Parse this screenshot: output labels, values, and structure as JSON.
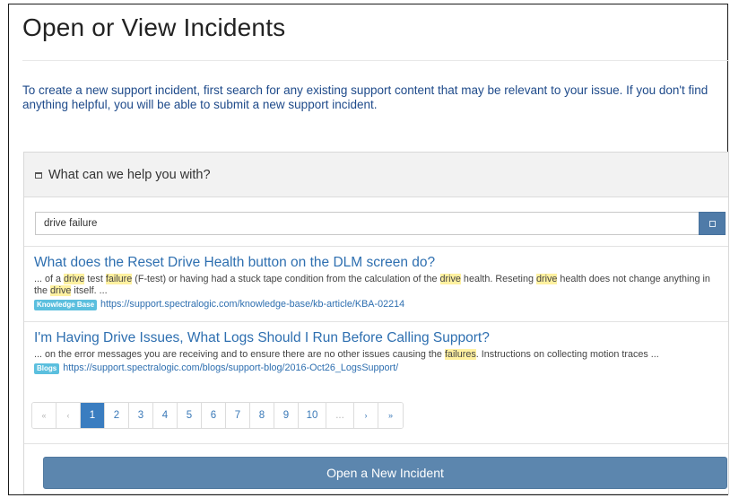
{
  "page": {
    "title": "Open or View Incidents",
    "intro": "To create a new support incident, first search for any existing support content that may be relevant to your issue.  If you don't find anything helpful, you will be able to submit a new support incident."
  },
  "panel": {
    "heading": "What can we help you with?",
    "heading_icon": "collapse-icon"
  },
  "search": {
    "value": "drive failure",
    "button_icon": "search-icon"
  },
  "results": [
    {
      "title": "What does the Reset Drive Health button on the DLM screen do?",
      "snippet_parts": [
        {
          "text": "... of a ",
          "hl": false
        },
        {
          "text": "drive",
          "hl": true
        },
        {
          "text": " test ",
          "hl": false
        },
        {
          "text": "failure",
          "hl": true
        },
        {
          "text": " (F-test) or having had a stuck tape condition from the calculation of the ",
          "hl": false
        },
        {
          "text": "drive",
          "hl": true
        },
        {
          "text": " health. Reseting ",
          "hl": false
        },
        {
          "text": "drive",
          "hl": true
        },
        {
          "text": " health does not change anything in the ",
          "hl": false
        },
        {
          "text": "drive",
          "hl": true
        },
        {
          "text": " itself. ...",
          "hl": false
        }
      ],
      "badge": "Knowledge Base",
      "url": "https://support.spectralogic.com/knowledge-base/kb-article/KBA-02214"
    },
    {
      "title": "I'm Having Drive Issues, What Logs Should I Run Before Calling Support?",
      "snippet_parts": [
        {
          "text": "... on the error messages you are receiving and to ensure there are no other issues causing the ",
          "hl": false
        },
        {
          "text": "failures",
          "hl": true
        },
        {
          "text": ". Instructions on collecting motion traces ...",
          "hl": false
        }
      ],
      "badge": "Blogs",
      "url": "https://support.spectralogic.com/blogs/support-blog/2016-Oct26_LogsSupport/"
    }
  ],
  "pagination": {
    "first": "«",
    "prev": "‹",
    "pages": [
      "1",
      "2",
      "3",
      "4",
      "5",
      "6",
      "7",
      "8",
      "9",
      "10"
    ],
    "active": "1",
    "ellipsis": "...",
    "next": "›",
    "last": "»"
  },
  "actions": {
    "open_incident": "Open a New Incident"
  },
  "colors": {
    "link": "#2e6fb0",
    "intro_text": "#1e4a8a",
    "primary_button": "#5c86ae",
    "search_button": "#4f7ba8",
    "badge": "#5bbfde",
    "highlight": "#fff1a0",
    "active_page": "#3a7dc0"
  }
}
